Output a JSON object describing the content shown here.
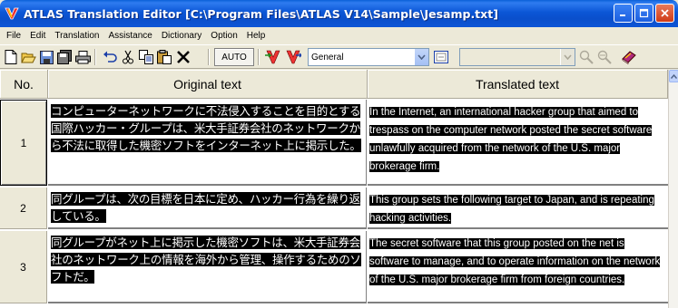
{
  "window": {
    "title": "ATLAS Translation Editor  [C:\\Program Files\\ATLAS V14\\Sample\\Jesamp.txt]",
    "icon": "atlas-app-icon"
  },
  "menu": [
    "File",
    "Edit",
    "Translation",
    "Assistance",
    "Dictionary",
    "Option",
    "Help"
  ],
  "toolbar": {
    "auto_label": "AUTO",
    "field_dropdown_value": "General",
    "icons": [
      "new-doc-icon",
      "open-folder-icon",
      "save-icon",
      "save-all-icon",
      "print-icon",
      "undo-icon",
      "cut-icon",
      "copy-icon",
      "paste-icon",
      "delete-icon",
      "translate-icon",
      "dictionary-icon",
      "find-icon",
      "replace-icon",
      "book-icon"
    ]
  },
  "grid": {
    "headers": {
      "no": "No.",
      "original": "Original text",
      "translated": "Translated text"
    },
    "rows": [
      {
        "no": "1",
        "original": "コンピューターネットワークに不法侵入することを目的とする国際ハッカー・グループは、米大手証券会社のネットワークから不法に取得した機密ソフトをインターネット上に掲示した。",
        "translated": "In the Internet, an international hacker group that aimed to trespass on the computer network posted the secret software unlawfully acquired from the network of the U.S. major brokerage firm."
      },
      {
        "no": "2",
        "original": "同グループは、次の目標を日本に定め、ハッカー行為を繰り返している。",
        "translated": "This group sets the following target to Japan, and is repeating hacking activities."
      },
      {
        "no": "3",
        "original": "同グループがネット上に掲示した機密ソフトは、米大手証券会社のネットワーク上の情報を海外から管理、操作するためのソフトだ。",
        "translated": "The secret software that this group posted on the net is software to manage, and to operate information on the network of the U.S. major brokerage firm from foreign countries."
      }
    ]
  },
  "colors": {
    "titlebar": "#0a56d6",
    "highlight_bg": "#000000",
    "highlight_fg": "#ffffff",
    "chrome": "#ece9d8"
  }
}
